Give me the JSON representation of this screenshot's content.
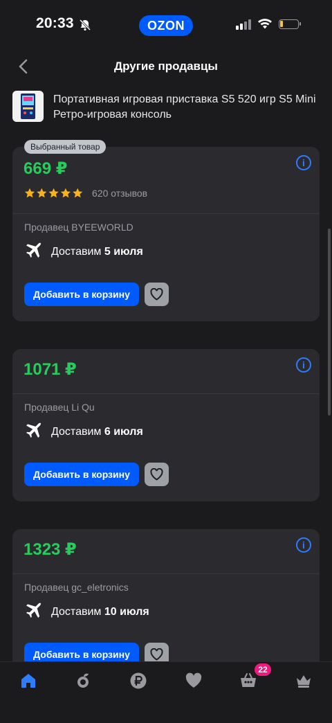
{
  "status_bar": {
    "time": "20:33",
    "brand": "OZON"
  },
  "header": {
    "title": "Другие продавцы"
  },
  "product": {
    "name": "Портативная игровая приставка S5 520 игр S5 Mini Ретро-игровая консоль"
  },
  "offers": [
    {
      "badge": "Выбранный товар",
      "price": "669 ₽",
      "rating_stars": 5,
      "reviews": "620 отзывов",
      "seller": "Продавец BYEEWORLD",
      "delivery_prefix": "Доставим",
      "delivery_date": "5 июля",
      "add_label": "Добавить в корзину"
    },
    {
      "price": "1071 ₽",
      "seller": "Продавец Li Qu",
      "delivery_prefix": "Доставим",
      "delivery_date": "6 июля",
      "add_label": "Добавить в корзину"
    },
    {
      "price": "1323 ₽",
      "seller": "Продавец gc_eletronics",
      "delivery_prefix": "Доставим",
      "delivery_date": "10 июля",
      "add_label": "Добавить в корзину"
    }
  ],
  "bottom_nav": {
    "items": [
      "home-icon",
      "fresh-icon",
      "ruble-icon",
      "favorites-icon",
      "cart-icon",
      "crown-icon"
    ],
    "cart_count": "22"
  },
  "colors": {
    "accent": "#005bff",
    "price": "#28cc5d",
    "badge": "#f0197d"
  }
}
